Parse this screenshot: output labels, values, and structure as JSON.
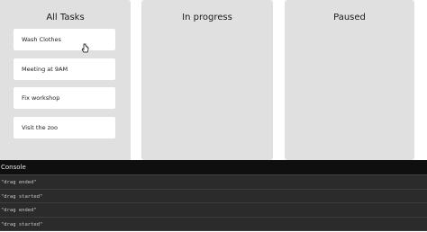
{
  "columns": [
    {
      "title": "All Tasks",
      "cards": [
        "Wash Clothes",
        "Meeting at 9AM",
        "Fix workshop",
        "Visit the zoo"
      ]
    },
    {
      "title": "In progress",
      "cards": []
    },
    {
      "title": "Paused",
      "cards": []
    }
  ],
  "console": {
    "title": "Console",
    "lines": [
      "\"drag ended\"",
      "\"drag started\"",
      "\"drag ended\"",
      "\"drag started\""
    ]
  }
}
